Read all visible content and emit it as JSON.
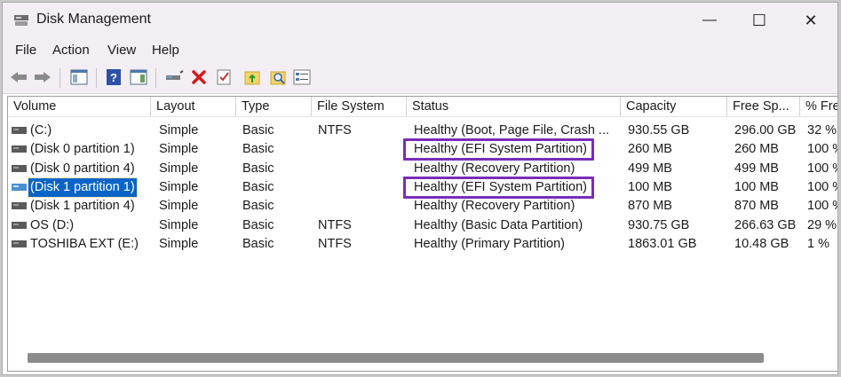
{
  "window": {
    "title": "Disk Management",
    "controls": {
      "minimize": "—",
      "maximize": "☐",
      "close": "✕"
    }
  },
  "menu": [
    "File",
    "Action",
    "View",
    "Help"
  ],
  "toolbar": {
    "icons": [
      "back-arrow-icon",
      "forward-arrow-icon",
      "console-tree-icon",
      "help-icon",
      "properties-icon",
      "connect-disk-icon",
      "delete-icon",
      "check-icon",
      "open-folder-icon",
      "explore-icon",
      "list-view-icon"
    ]
  },
  "columns": [
    "Volume",
    "Layout",
    "Type",
    "File System",
    "Status",
    "Capacity",
    "Free Sp...",
    "% Fre"
  ],
  "rows": [
    {
      "volume": "(C:)",
      "layout": "Simple",
      "type": "Basic",
      "fs": "NTFS",
      "status": "Healthy (Boot, Page File, Crash ...",
      "capacity": "930.55 GB",
      "free": "296.00 GB",
      "pct": "32 %",
      "selected": false,
      "highlighted": false
    },
    {
      "volume": "(Disk 0 partition 1)",
      "layout": "Simple",
      "type": "Basic",
      "fs": "",
      "status": "Healthy (EFI System Partition)",
      "capacity": "260 MB",
      "free": "260 MB",
      "pct": "100 %",
      "selected": false,
      "highlighted": true
    },
    {
      "volume": "(Disk 0 partition 4)",
      "layout": "Simple",
      "type": "Basic",
      "fs": "",
      "status": "Healthy (Recovery Partition)",
      "capacity": "499 MB",
      "free": "499 MB",
      "pct": "100 %",
      "selected": false,
      "highlighted": false
    },
    {
      "volume": "(Disk 1 partition 1)",
      "layout": "Simple",
      "type": "Basic",
      "fs": "",
      "status": "Healthy (EFI System Partition)",
      "capacity": "100 MB",
      "free": "100 MB",
      "pct": "100 %",
      "selected": true,
      "highlighted": true
    },
    {
      "volume": "(Disk 1 partition 4)",
      "layout": "Simple",
      "type": "Basic",
      "fs": "",
      "status": "Healthy (Recovery Partition)",
      "capacity": "870 MB",
      "free": "870 MB",
      "pct": "100 %",
      "selected": false,
      "highlighted": false
    },
    {
      "volume": "OS (D:)",
      "layout": "Simple",
      "type": "Basic",
      "fs": "NTFS",
      "status": "Healthy (Basic Data Partition)",
      "capacity": "930.75 GB",
      "free": "266.63 GB",
      "pct": "29 %",
      "selected": false,
      "highlighted": false
    },
    {
      "volume": "TOSHIBA EXT (E:)",
      "layout": "Simple",
      "type": "Basic",
      "fs": "NTFS",
      "status": "Healthy (Primary Partition)",
      "capacity": "1863.01 GB",
      "free": "10.48 GB",
      "pct": "1 %",
      "selected": false,
      "highlighted": false
    }
  ],
  "colors": {
    "selection": "#0a64c8",
    "highlight_box": "#7a2cb8",
    "titlebar": "#f3eef3"
  }
}
